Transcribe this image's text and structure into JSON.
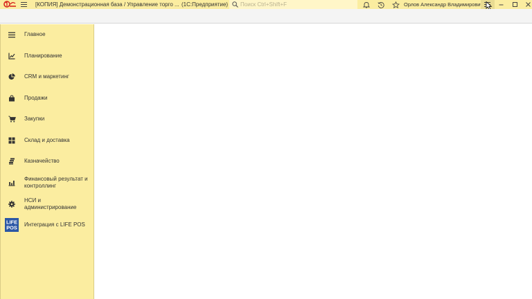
{
  "titlebar": {
    "logo_text": "1С",
    "title": "[КОПИЯ] Демонстрационная база / Управление торго ...",
    "mode": "(1С:Предприятие)",
    "search_placeholder": "Поиск Ctrl+Shift+F",
    "user": "Орлов Александр Владимирович",
    "icons": [
      "bell-icon",
      "history-icon",
      "star-icon",
      "menu-icon",
      "minimize-icon",
      "maximize-icon",
      "close-icon"
    ]
  },
  "sidebar": {
    "items": [
      {
        "label": "Главное",
        "icon": "menu-lines-icon"
      },
      {
        "label": "Планирование",
        "icon": "chart-line-icon"
      },
      {
        "label": "CRM и маркетинг",
        "icon": "pie-chart-icon"
      },
      {
        "label": "Продажи",
        "icon": "shopping-bag-icon"
      },
      {
        "label": "Закупки",
        "icon": "cart-icon"
      },
      {
        "label": "Склад и доставка",
        "icon": "warehouse-grid-icon"
      },
      {
        "label": "Казначейство",
        "icon": "coins-icon"
      },
      {
        "label": "Финансовый результат и контроллинг",
        "icon": "bar-chart-icon"
      },
      {
        "label": "НСИ и администрирование",
        "icon": "gear-icon"
      },
      {
        "label": "Интеграция с LIFE POS",
        "icon": "life-pos-logo-icon",
        "logo_lines": [
          "LIFE",
          "POS"
        ]
      }
    ]
  },
  "colors": {
    "panel": "#fbeda0",
    "logo_red": "#d8261f",
    "life_pos_blue": "#2b57a5"
  }
}
